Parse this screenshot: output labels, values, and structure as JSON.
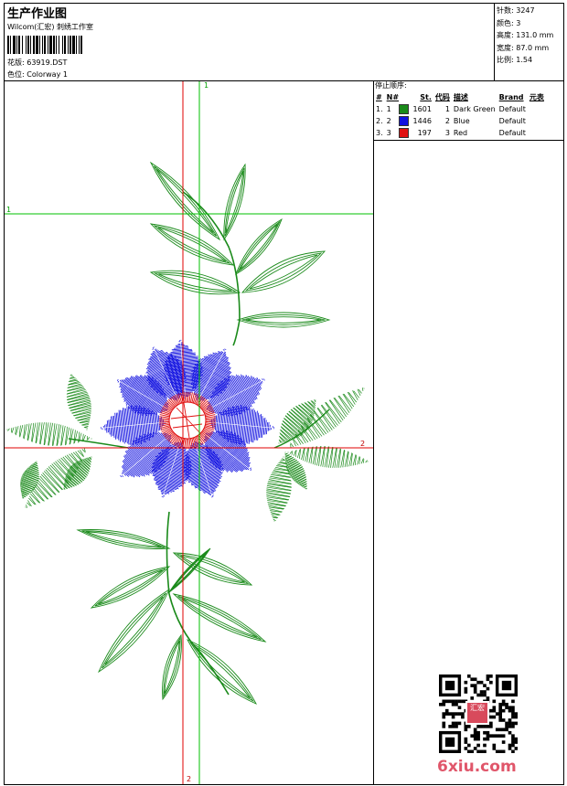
{
  "header": {
    "title": "生产作业图",
    "company": "Wilcom(汇宏) 刺绣工作室",
    "design_label": "花版:",
    "design_value": "63919.DST",
    "colorway_label": "色位:",
    "colorway_value": "Colorway 1"
  },
  "stats": [
    {
      "label": "针数:",
      "value": "3247"
    },
    {
      "label": "颜色:",
      "value": "3"
    },
    {
      "label": "高度:",
      "value": "131.0 mm"
    },
    {
      "label": "宽度:",
      "value": "87.0 mm"
    },
    {
      "label": "比例:",
      "value": "1.54"
    }
  ],
  "stop_sequence": {
    "title": "停止顺序:",
    "columns": [
      "#",
      "N#",
      "St.",
      "代码",
      "描述",
      "Brand",
      "元表"
    ],
    "rows": [
      {
        "index": "1.",
        "needle": "1",
        "color": "#1a8a1a",
        "stitches": "1601",
        "code": "1",
        "description": "Dark Green",
        "brand": "Default"
      },
      {
        "index": "2.",
        "needle": "2",
        "color": "#1010e0",
        "stitches": "1446",
        "code": "2",
        "description": "Blue",
        "brand": "Default"
      },
      {
        "index": "3.",
        "needle": "3",
        "color": "#e01010",
        "stitches": "197",
        "code": "3",
        "description": "Red",
        "brand": "Default"
      }
    ]
  },
  "guides": {
    "top": "1",
    "left": "1",
    "right": "2",
    "bottom": "2"
  },
  "watermark": "6xiu.com",
  "qr_seal": "汇宏",
  "colors": {
    "green": "#1a8a1a",
    "blue": "#1010e0",
    "red": "#e01010",
    "guide_red": "#e00000",
    "guide_green": "#00c000"
  }
}
